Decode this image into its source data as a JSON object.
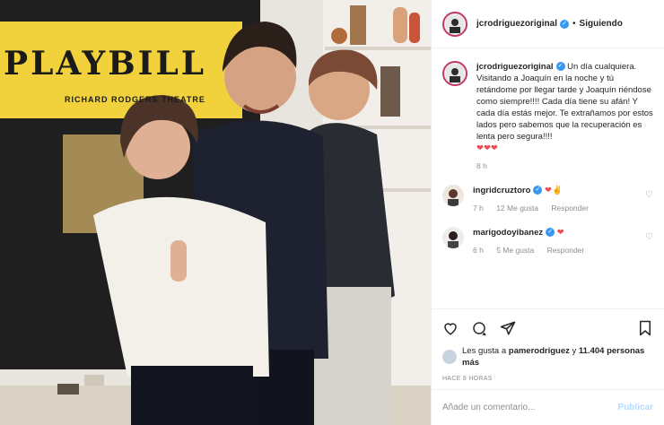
{
  "post": {
    "username": "jcrodriguezoriginal",
    "follow_status": "Siguiendo",
    "dot": "•",
    "caption": "Un día cualquiera. Visitando a Joaquín en la noche y tú retándome por llegar tarde y Joaquín riéndose como siempre!!!! Cada día tiene su afán! Y cada día estás mejor. Te extrañamos por estos lados pero sabemos que la recuperación es lenta pero segura!!!!",
    "caption_hearts": "❤❤❤",
    "caption_time": "8 h",
    "poster_title": "PLAYBILL",
    "poster_sub": "RICHARD RODGERS THEATRE"
  },
  "comments": [
    {
      "username": "ingridcruztoro",
      "text": "❤✌",
      "time": "7 h",
      "likes": "12 Me gusta",
      "reply": "Responder"
    },
    {
      "username": "marigodoyibanez",
      "text": "❤",
      "time": "6 h",
      "likes": "5 Me gusta",
      "reply": "Responder"
    }
  ],
  "likes": {
    "text_prefix": "Les gusta a ",
    "user": "pamerodriguez",
    "text_mid": " y ",
    "count": "11.404 personas más"
  },
  "time_ago": "HACE 8 HORAS",
  "comment_input": {
    "placeholder": "Añade un comentario...",
    "value": ""
  },
  "publish_label": "Publicar",
  "icons": {
    "verified": "verified-badge-icon",
    "like": "heart-icon",
    "comment": "comment-bubble-icon",
    "share": "paper-plane-icon",
    "save": "bookmark-icon",
    "comment_like": "small-heart-icon"
  },
  "colors": {
    "verified": "#3897f0",
    "heart": "#ed4956",
    "muted": "#8e8e8e",
    "publish_disabled": "#b3dbff",
    "story_ring": "#c03a63"
  }
}
